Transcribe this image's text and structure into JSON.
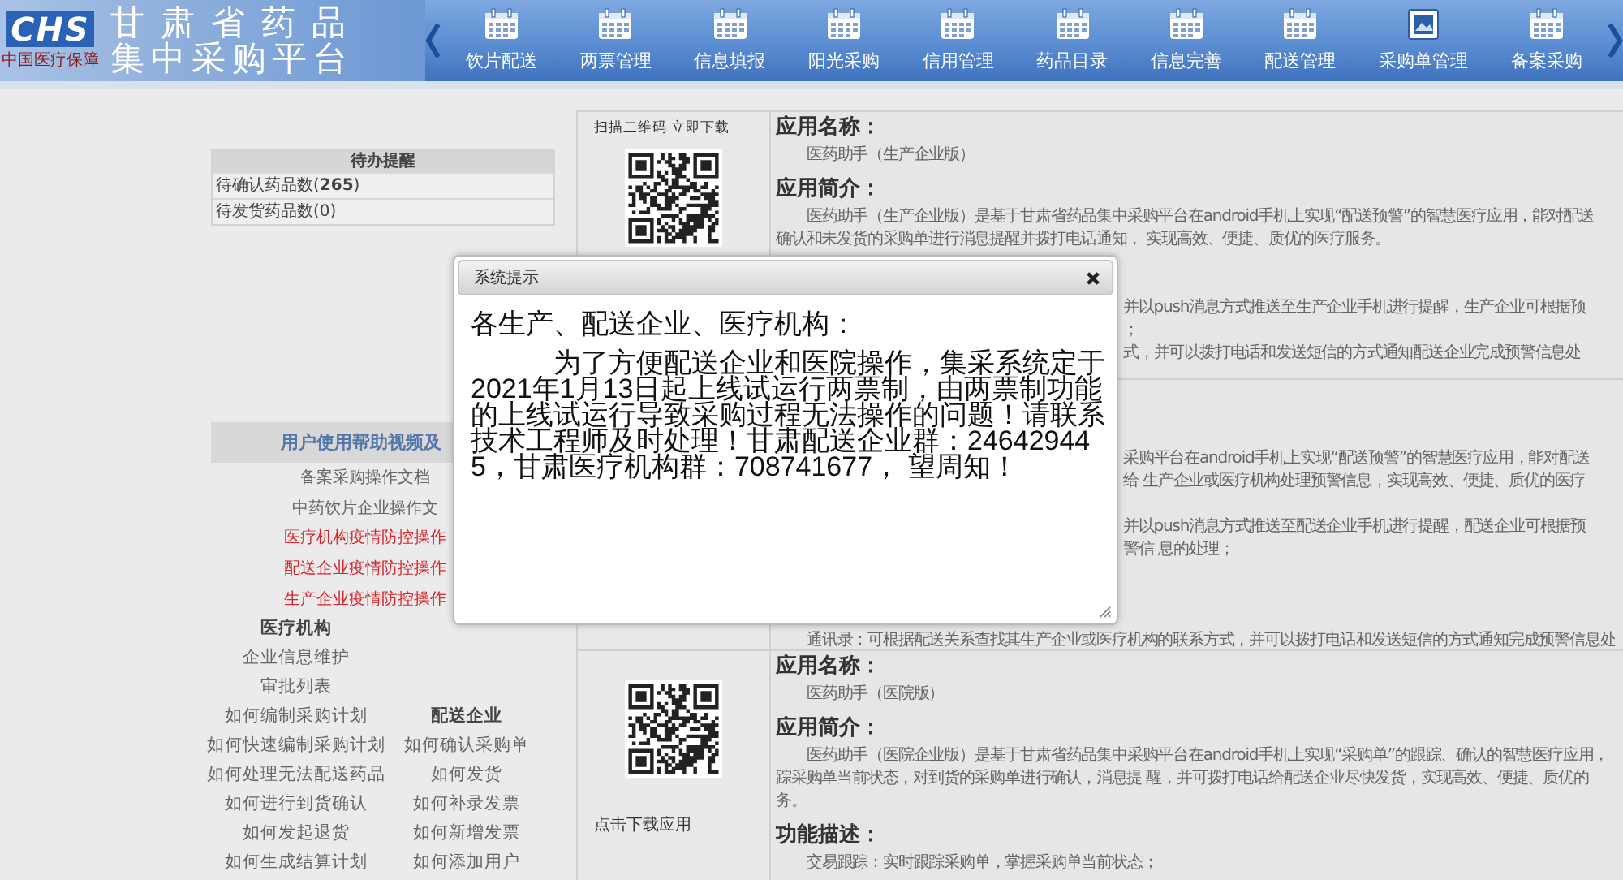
{
  "header": {
    "logo": {
      "mark": "CHS",
      "caption": "中国医疗保障"
    },
    "title_lines": [
      "甘肃省药品",
      "集中采购平台"
    ],
    "nav": [
      {
        "label": "饮片配送",
        "kind": "calendar"
      },
      {
        "label": "两票管理",
        "kind": "calendar"
      },
      {
        "label": "信息填报",
        "kind": "calendar"
      },
      {
        "label": "阳光采购",
        "kind": "calendar"
      },
      {
        "label": "信用管理",
        "kind": "calendar"
      },
      {
        "label": "药品目录",
        "kind": "calendar"
      },
      {
        "label": "信息完善",
        "kind": "calendar"
      },
      {
        "label": "配送管理",
        "kind": "calendar"
      },
      {
        "label": "采购单管理",
        "kind": "frame"
      },
      {
        "label": "备案采购",
        "kind": "calendar"
      }
    ]
  },
  "todo": {
    "title": "待办提醒",
    "rows": [
      "待确认药品数(**265**)",
      "待发货药品数(0)"
    ]
  },
  "help": {
    "title": "用户使用帮助视频及",
    "links": [
      {
        "text": "备案采购操作文档",
        "color": "#666666"
      },
      {
        "text": "中药饮片企业操作文",
        "color": "#666666"
      },
      {
        "text": "医疗机构疫情防控操作",
        "color": "#d9262c"
      },
      {
        "text": "配送企业疫情防控操作",
        "color": "#d9262c"
      },
      {
        "text": "生产企业疫情防控操作",
        "color": "#d9262c"
      }
    ],
    "groups": [
      {
        "title": "医疗机构",
        "items": [
          "企业信息维护",
          "审批列表",
          "如何编制采购计划",
          "如何快速编制采购计划",
          "如何处理无法配送药品",
          "如何进行到货确认",
          "如何发起退货",
          "如何生成结算计划"
        ]
      },
      {
        "title": "配送企业",
        "items": [
          "如何确认采购单",
          "如何发货",
          "如何补录发票",
          "如何新增发票",
          "如何添加用户"
        ]
      }
    ]
  },
  "apps": [
    {
      "qr_code": true,
      "caption_top": "扫描二维码 立即下载",
      "lines": [
        {
          "kind": "heading",
          "text": "应用名称："
        },
        {
          "kind": "para",
          "text": "医药助手（生产企业版）"
        },
        {
          "kind": "heading",
          "text": "应用简介："
        },
        {
          "kind": "para",
          "text": "医药助手（生产企业版）是基于甘肃省药品集中采购平台在android手机上实现“配送预警”的智慧医疗应用，能对配送"
        },
        {
          "kind": "cont",
          "text": "确认和未发货的采购单进行消息提醒并拨打电话通知， 实现高效、便捷、质优的医疗服务。"
        },
        {
          "kind": "gap"
        },
        {
          "kind": "gap"
        },
        {
          "kind": "tail",
          "text": "并以push消息方式推送至生产企业手机进行提醒，生产企业可根据预"
        },
        {
          "kind": "tail",
          "text": "；"
        },
        {
          "kind": "tail",
          "text": "式，并可以拨打电话和发送短信的方式通知配送企业完成预警信息处"
        }
      ]
    },
    {
      "qr_code": false,
      "lines": [
        {
          "kind": "gap"
        },
        {
          "kind": "gap"
        },
        {
          "kind": "gap"
        },
        {
          "kind": "tail",
          "text": "采购平台在android手机上实现“配送预警”的智慧医疗应用，能对配送"
        },
        {
          "kind": "tail",
          "text": "给 生产企业或医疗机构处理预警信息，实现高效、便捷、质优的医疗"
        },
        {
          "kind": "gap"
        },
        {
          "kind": "tail",
          "text": "并以push消息方式推送至配送企业手机进行提醒，配送企业可根据预"
        },
        {
          "kind": "tail",
          "text": "警信 息的处理；"
        },
        {
          "kind": "gap"
        },
        {
          "kind": "gap"
        },
        {
          "kind": "gap"
        },
        {
          "kind": "para",
          "text": "通讯录：可根据配送关系查找其生产企业或医疗机构的联系方式，并可以拨打电话和发送短信的方式通知完成预警信息处"
        }
      ]
    },
    {
      "qr_code": true,
      "caption_bottom": "点击下载应用",
      "lines": [
        {
          "kind": "heading",
          "text": "应用名称："
        },
        {
          "kind": "para",
          "text": "医药助手（医院版）"
        },
        {
          "kind": "heading",
          "text": "应用简介："
        },
        {
          "kind": "para",
          "text": "医药助手（医院企业版）是基于甘肃省药品集中采购平台在android手机上实现“采购单”的跟踪、确认的智慧医疗应用，"
        },
        {
          "kind": "cont",
          "text": "踪采购单当前状态，对到货的采购单进行确认，消息提 醒，并可拨打电话给配送企业尽快发货，实现高效、便捷、质优的"
        },
        {
          "kind": "cont",
          "text": "务。"
        },
        {
          "kind": "heading",
          "text": "功能描述："
        },
        {
          "kind": "para",
          "text": "交易跟踪：实时跟踪采购单，掌握采购单当前状态；"
        }
      ]
    }
  ],
  "dialog": {
    "title": "系统提示",
    "heading": "各生产、配送企业、医疗机构：",
    "body": "为了方便配送企业和医院操作，集采系统定于2021年1月13日起上线试运行两票制，由两票制功能的上线试运行导致采购过程无法操作的问题！请联系技术工程师及时处理！甘肃配送企业群：246429445，甘肃医疗机构群：708741677， 望周知！"
  }
}
